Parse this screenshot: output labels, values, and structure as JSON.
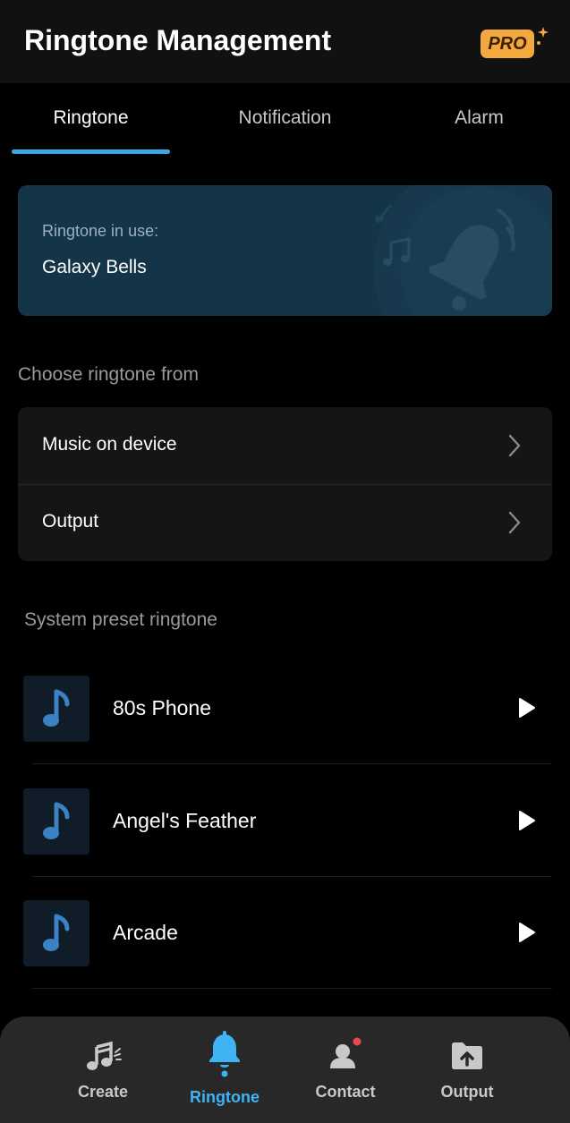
{
  "header": {
    "title": "Ringtone Management",
    "pro_badge": "PRO"
  },
  "tabs": [
    {
      "label": "Ringtone",
      "active": true
    },
    {
      "label": "Notification",
      "active": false
    },
    {
      "label": "Alarm",
      "active": false
    }
  ],
  "current": {
    "label": "Ringtone in use:",
    "value": "Galaxy Bells"
  },
  "choose": {
    "title": "Choose ringtone from",
    "items": [
      {
        "label": "Music on device"
      },
      {
        "label": "Output"
      }
    ]
  },
  "presets": {
    "title": "System preset ringtone",
    "items": [
      {
        "name": "80s Phone"
      },
      {
        "name": "Angel's Feather"
      },
      {
        "name": "Arcade"
      }
    ]
  },
  "nav": {
    "items": [
      {
        "label": "Create",
        "icon": "music-notes-icon",
        "active": false
      },
      {
        "label": "Ringtone",
        "icon": "bell-icon",
        "active": true
      },
      {
        "label": "Contact",
        "icon": "contact-icon",
        "active": false
      },
      {
        "label": "Output",
        "icon": "folder-upload-icon",
        "active": false
      }
    ]
  },
  "colors": {
    "accent": "#3aa7e6",
    "pro_badge": "#f3a93d",
    "card_bg": "#143447",
    "header_bg": "#111111",
    "nav_bg": "#282828",
    "notification_dot": "#e8474f"
  }
}
